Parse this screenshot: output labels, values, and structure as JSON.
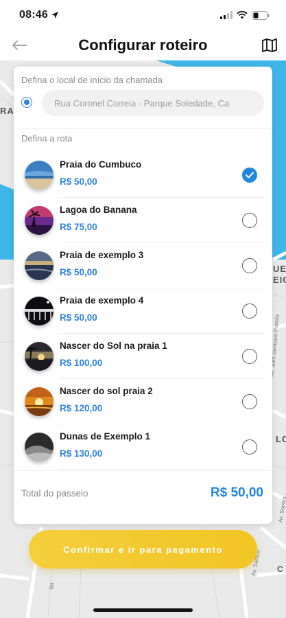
{
  "status_bar": {
    "time": "08:46"
  },
  "header": {
    "title": "Configurar roteiro"
  },
  "map": {
    "labels": [
      "RAL",
      "UE",
      "EIC",
      "LO",
      "C"
    ],
    "streets": [
      "Av. Júlio Sampaio Portela",
      "Av. Santos",
      "Av. Sampa",
      "Ba"
    ]
  },
  "start_section": {
    "label": "Defina o local de início da chamada",
    "value": "Rua Coronel Correia - Parque Soledade, Ca"
  },
  "route_section": {
    "label": "Defina a rota",
    "items": [
      {
        "name": "Praia do Cumbuco",
        "price": "R$ 50,00",
        "selected": true,
        "thumb": "beach"
      },
      {
        "name": "Lagoa do Banana",
        "price": "R$ 75,00",
        "selected": false,
        "thumb": "lagoon-sunset"
      },
      {
        "name": "Praia de exemplo 3",
        "price": "R$ 50,00",
        "selected": false,
        "thumb": "dusk-sea"
      },
      {
        "name": "Praia de exemplo 4",
        "price": "R$ 50,00",
        "selected": false,
        "thumb": "pier-night"
      },
      {
        "name": "Nascer do Sol na praia 1",
        "price": "R$ 100,00",
        "selected": false,
        "thumb": "sunrise-palms"
      },
      {
        "name": "Nascer do sol praia 2",
        "price": "R$ 120,00",
        "selected": false,
        "thumb": "golden-sunrise"
      },
      {
        "name": "Dunas de Exemplo 1",
        "price": "R$ 130,00",
        "selected": false,
        "thumb": "dunes"
      }
    ]
  },
  "total": {
    "label": "Total do passeio",
    "value": "R$ 50,00"
  },
  "confirm_button": {
    "label": "Confirmar e ir para pagamento"
  },
  "colors": {
    "accent": "#1f86e0",
    "button": "#f2c82c",
    "water": "#3fb6ea"
  }
}
